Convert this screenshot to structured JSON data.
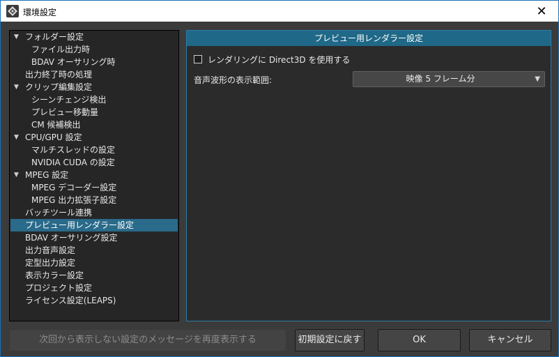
{
  "window": {
    "title": "環境設定",
    "close_symbol": "✕"
  },
  "tree": {
    "items": [
      {
        "label": "フォルダー設定",
        "expanded": true
      },
      {
        "label": "ファイル出力時"
      },
      {
        "label": "BDAV オーサリング時"
      },
      {
        "label": "出力終了時の処理"
      },
      {
        "label": "クリップ編集設定",
        "expanded": true
      },
      {
        "label": "シーンチェンジ検出"
      },
      {
        "label": "プレビュー移動量"
      },
      {
        "label": "CM 候補検出"
      },
      {
        "label": "CPU/GPU 設定",
        "expanded": true
      },
      {
        "label": "マルチスレッドの設定"
      },
      {
        "label": "NVIDIA CUDA の設定"
      },
      {
        "label": "MPEG 設定",
        "expanded": true
      },
      {
        "label": "MPEG デコーダー設定"
      },
      {
        "label": "MPEG 出力拡張子設定"
      },
      {
        "label": "バッチツール連携"
      },
      {
        "label": "プレビュー用レンダラー設定",
        "selected": true
      },
      {
        "label": "BDAV オーサリング設定"
      },
      {
        "label": "出力音声設定"
      },
      {
        "label": "定型出力設定"
      },
      {
        "label": "表示カラー設定"
      },
      {
        "label": "プロジェクト設定"
      },
      {
        "label": "ライセンス設定(LEAPS)"
      }
    ],
    "expand_symbol": "▼"
  },
  "panel": {
    "header": "プレビュー用レンダラー設定",
    "direct3d_checkbox": {
      "label": "レンダリングに Direct3D を使用する",
      "checked": false
    },
    "waveform_range": {
      "label": "音声波形の表示範囲:",
      "value": "映像 5 フレーム分",
      "arrow": "▼"
    }
  },
  "buttons": {
    "show_messages": "次回から表示しない設定のメッセージを再度表示する",
    "reset": "初期設定に戻す",
    "ok": "OK",
    "cancel": "キャンセル"
  },
  "colors": {
    "selection": "#2a6a8a",
    "panel_header": "#1f6887",
    "panel_border": "#2a7ea6",
    "window_bg": "#3b3b3b"
  }
}
